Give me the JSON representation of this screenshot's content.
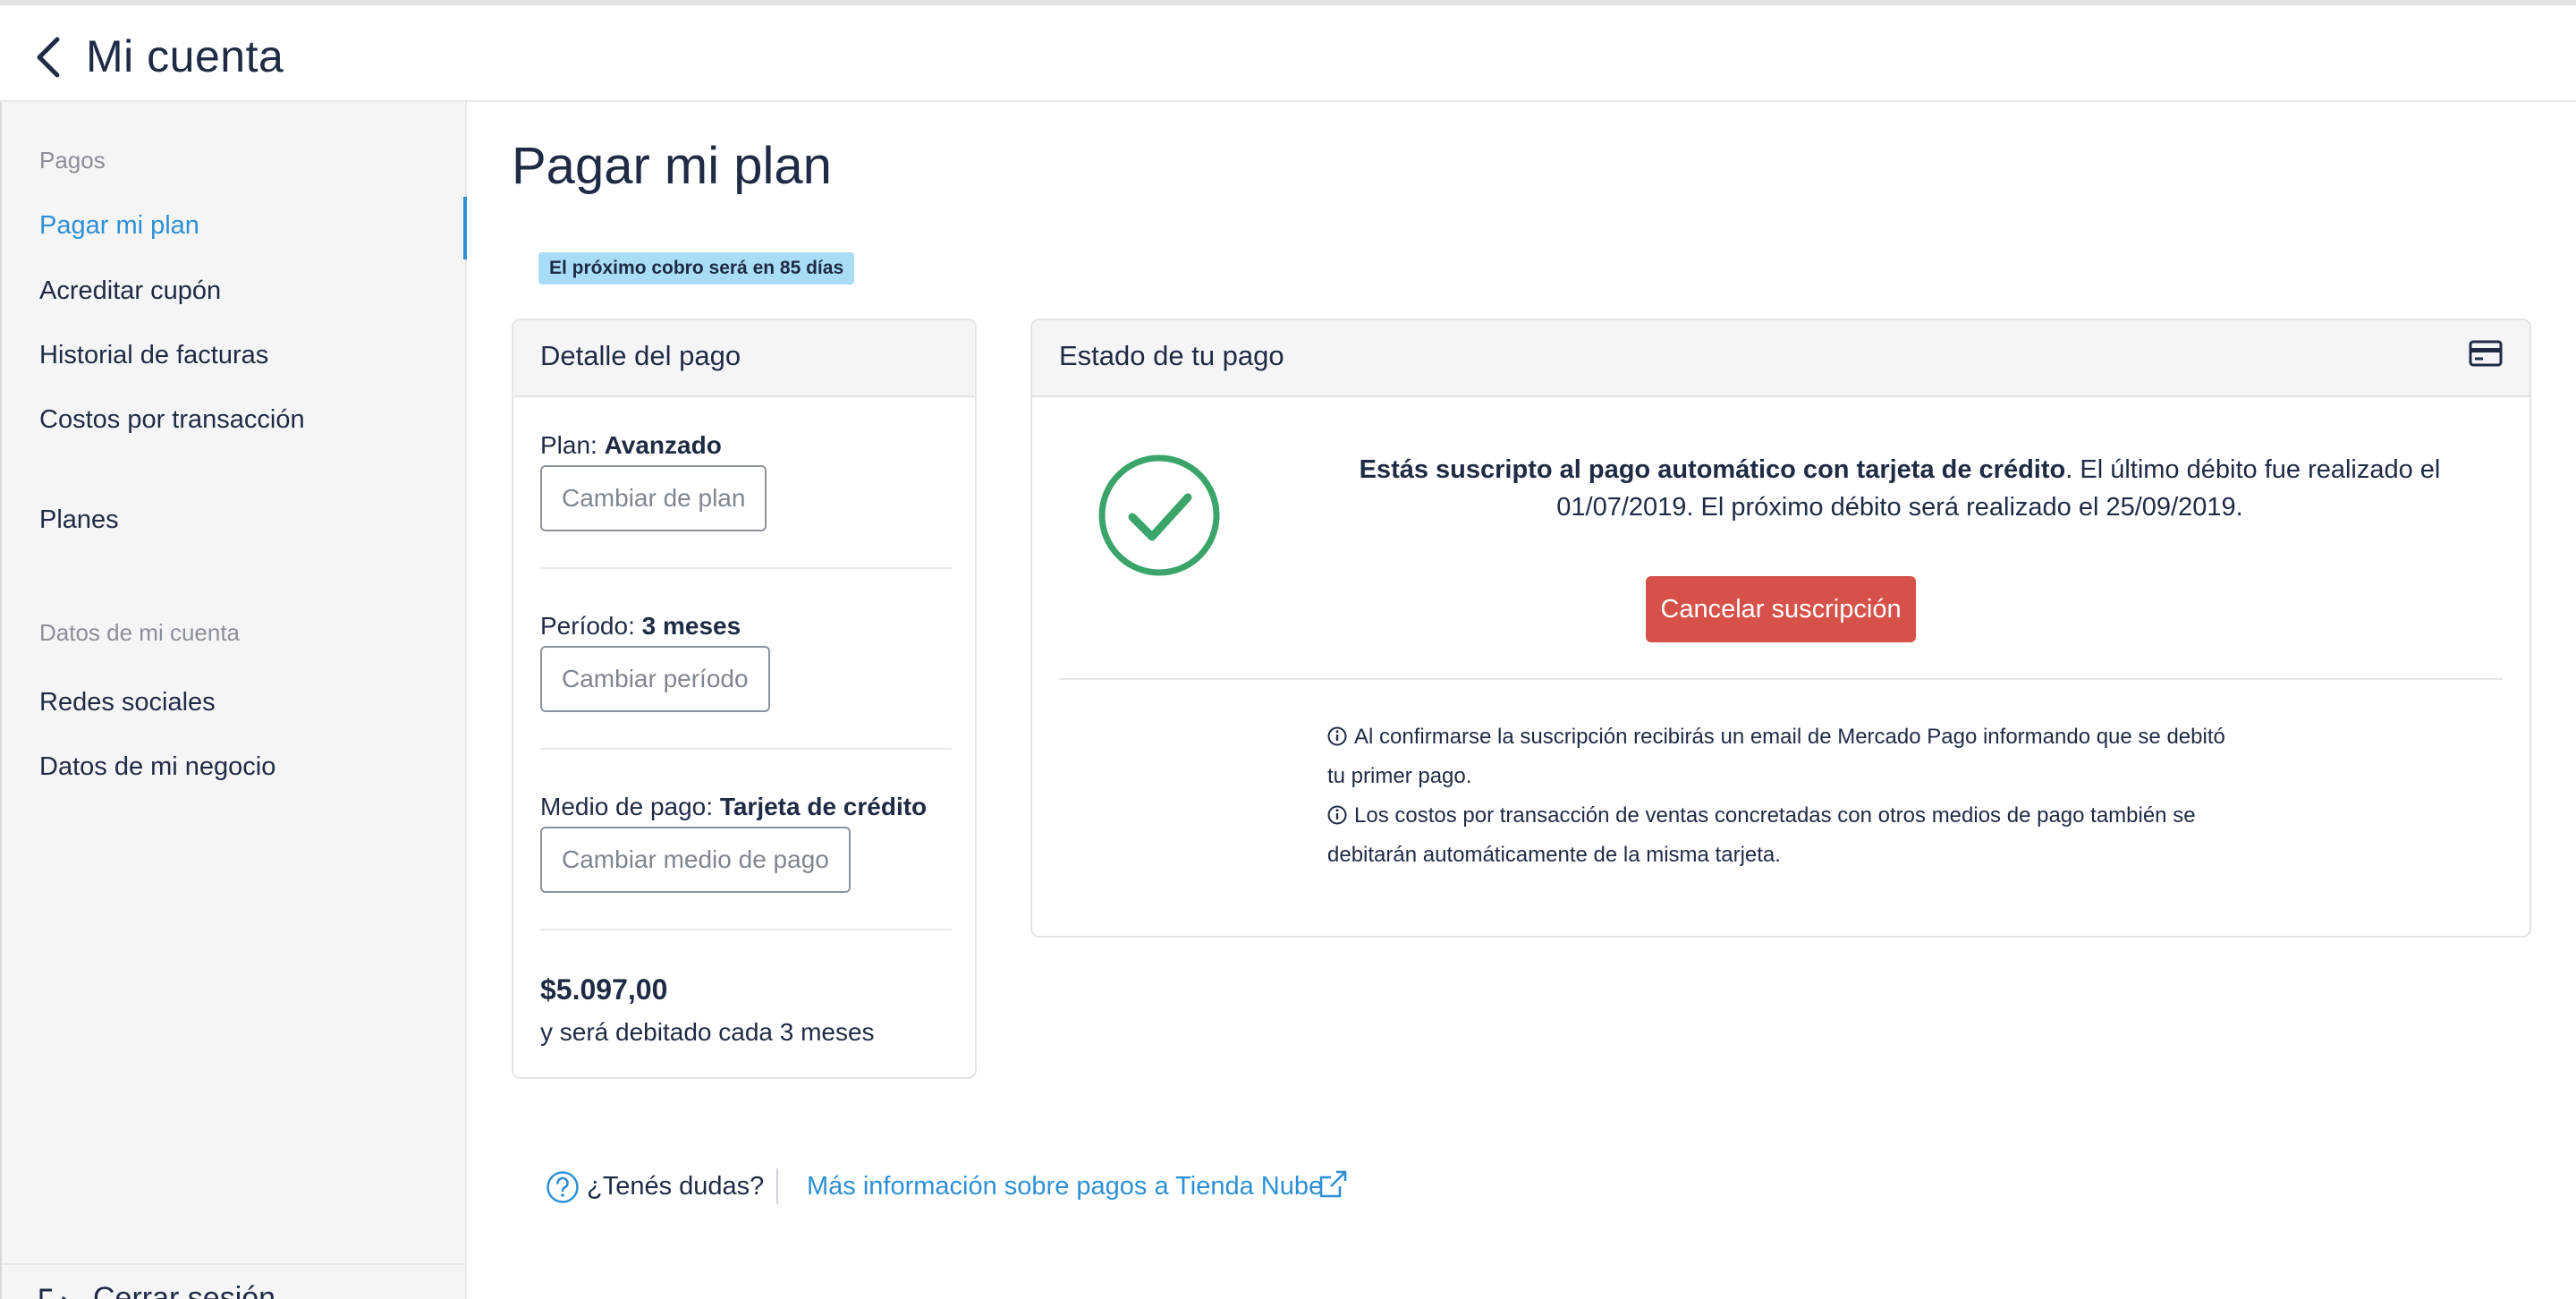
{
  "header": {
    "title": "Mi cuenta",
    "back_icon": "chevron-left-icon"
  },
  "sidebar": {
    "sections": [
      {
        "label": "Pagos"
      },
      {
        "label": "Datos de mi cuenta"
      }
    ],
    "items": [
      {
        "label": "Pagar mi plan",
        "active": true
      },
      {
        "label": "Acreditar cupón"
      },
      {
        "label": "Historial de facturas"
      },
      {
        "label": "Costos por transacción"
      },
      {
        "label": "Planes"
      },
      {
        "label": "Redes sociales"
      },
      {
        "label": "Datos de mi negocio"
      }
    ],
    "logout_label": "Cerrar sesión",
    "logout_icon": "logout-icon"
  },
  "main": {
    "title": "Pagar mi plan",
    "badge": "El próximo cobro será en 85 días"
  },
  "detail_card": {
    "title": "Detalle del pago",
    "plan_label": "Plan:",
    "plan_value": "Avanzado",
    "change_plan_button": "Cambiar de plan",
    "period_label": "Período:",
    "period_value": "3 meses",
    "change_period_button": "Cambiar período",
    "payment_label": "Medio de pago:",
    "payment_value": "Tarjeta de crédito",
    "change_payment_button": "Cambiar medio de pago",
    "price": "$5.097,00",
    "price_note": "y será debitado cada 3 meses"
  },
  "status_card": {
    "title": "Estado de tu pago",
    "title_icon": "credit-card-icon",
    "status_icon": "check-circle-icon",
    "message_bold": "Estás suscripto al pago automático con tarjeta de crédito",
    "message_rest": ". El último débito fue realizado el 01/07/2019. El próximo débito será realizado el 25/09/2019.",
    "cancel_button": "Cancelar suscripción",
    "info_1_line_1": "Al confirmarse la suscripción recibirás un email de Mercado Pago informando que se debitó",
    "info_1_line_2": "tu primer pago.",
    "info_2_line_1": "Los costos por transacción de ventas concretadas con otros medios de pago también se",
    "info_2_line_2": "debitarán automáticamente de la misma tarjeta."
  },
  "help": {
    "question": "¿Tenés dudas?",
    "link": "Más información sobre pagos a Tienda Nube",
    "question_icon": "question-circle-icon",
    "link_icon": "external-link-icon"
  },
  "colors": {
    "accent": "#2d8fd5",
    "danger": "#d6514a",
    "success": "#3aa46a",
    "badge_bg": "#a9ddf7",
    "text": "#1f2a44"
  }
}
